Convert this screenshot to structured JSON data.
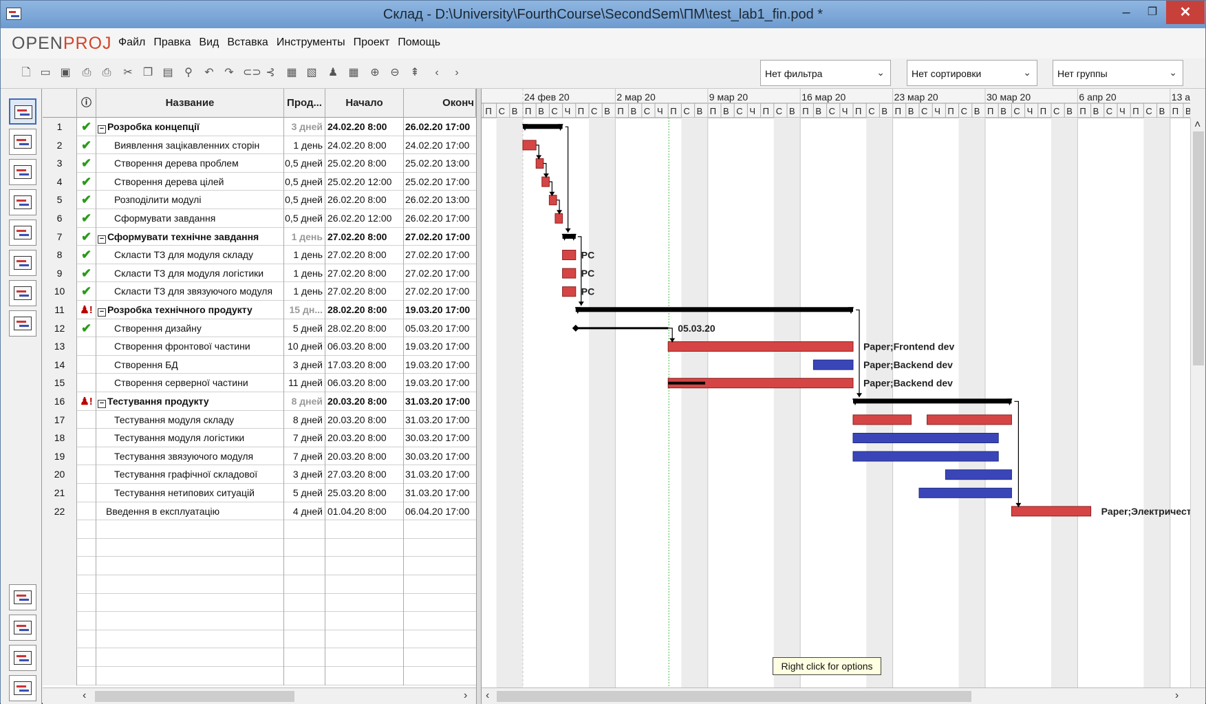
{
  "window": {
    "title": "Склад - D:\\University\\FourthCourse\\SecondSem\\ПМ\\test_lab1_fin.pod *",
    "min": "–",
    "max": "❐",
    "close": "✕"
  },
  "logo": {
    "open": "OPEN",
    "proj": "PROJ"
  },
  "menu": [
    "Файл",
    "Правка",
    "Вид",
    "Вставка",
    "Инструменты",
    "Проект",
    "Помощь"
  ],
  "filters": {
    "filter": "Нет фильтра",
    "sort": "Нет сортировки",
    "group": "Нет группы"
  },
  "columns": {
    "info": "ⓘ",
    "name": "Название",
    "duration": "Прод...",
    "start": "Начало",
    "finish": "Оконч"
  },
  "tasks": [
    {
      "id": "1",
      "ind": "check",
      "name": "Розробка концепції",
      "dur": "3 дней",
      "start": "24.02.20 8:00",
      "end": "26.02.20 17:00",
      "summary": true
    },
    {
      "id": "2",
      "ind": "check",
      "name": "Виявлення зацікавленних сторін",
      "dur": "1 день",
      "start": "24.02.20 8:00",
      "end": "24.02.20 17:00"
    },
    {
      "id": "3",
      "ind": "check",
      "name": "Створення дерева проблем",
      "dur": "0,5 дней",
      "start": "25.02.20 8:00",
      "end": "25.02.20 13:00"
    },
    {
      "id": "4",
      "ind": "check",
      "name": "Створення дерева цілей",
      "dur": "0,5 дней",
      "start": "25.02.20 12:00",
      "end": "25.02.20 17:00"
    },
    {
      "id": "5",
      "ind": "check",
      "name": "Розподілити модулі",
      "dur": "0,5 дней",
      "start": "26.02.20 8:00",
      "end": "26.02.20 13:00"
    },
    {
      "id": "6",
      "ind": "check",
      "name": "Сформувати завдання",
      "dur": "0,5 дней",
      "start": "26.02.20 12:00",
      "end": "26.02.20 17:00"
    },
    {
      "id": "7",
      "ind": "check",
      "name": "Сформувати технічне завдання",
      "dur": "1 день",
      "start": "27.02.20 8:00",
      "end": "27.02.20 17:00",
      "summary": true
    },
    {
      "id": "8",
      "ind": "check",
      "name": "Скласти ТЗ для модуля складу",
      "dur": "1 день",
      "start": "27.02.20 8:00",
      "end": "27.02.20 17:00"
    },
    {
      "id": "9",
      "ind": "check",
      "name": "Скласти ТЗ для модуля логістики",
      "dur": "1 день",
      "start": "27.02.20 8:00",
      "end": "27.02.20 17:00"
    },
    {
      "id": "10",
      "ind": "check",
      "name": "Скласти ТЗ для звязуючого модуля",
      "dur": "1 день",
      "start": "27.02.20 8:00",
      "end": "27.02.20 17:00"
    },
    {
      "id": "11",
      "ind": "warn",
      "name": "Розробка технічного продукту",
      "dur": "15 дн...",
      "start": "28.02.20 8:00",
      "end": "19.03.20 17:00",
      "summary": true
    },
    {
      "id": "12",
      "ind": "check",
      "name": "Створення дизайну",
      "dur": "5 дней",
      "start": "28.02.20 8:00",
      "end": "05.03.20 17:00"
    },
    {
      "id": "13",
      "ind": "",
      "name": "Створення фронтової частини",
      "dur": "10 дней",
      "start": "06.03.20 8:00",
      "end": "19.03.20 17:00"
    },
    {
      "id": "14",
      "ind": "",
      "name": "Створення БД",
      "dur": "3 дней",
      "start": "17.03.20 8:00",
      "end": "19.03.20 17:00"
    },
    {
      "id": "15",
      "ind": "",
      "name": "Створення серверної частини",
      "dur": "11 дней",
      "start": "06.03.20 8:00",
      "end": "19.03.20 17:00"
    },
    {
      "id": "16",
      "ind": "warn",
      "name": "Тестування продукту",
      "dur": "8 дней",
      "start": "20.03.20 8:00",
      "end": "31.03.20 17:00",
      "summary": true
    },
    {
      "id": "17",
      "ind": "",
      "name": "Тестування модуля складу",
      "dur": "8 дней",
      "start": "20.03.20 8:00",
      "end": "31.03.20 17:00"
    },
    {
      "id": "18",
      "ind": "",
      "name": "Тестування модуля логістики",
      "dur": "7 дней",
      "start": "20.03.20 8:00",
      "end": "30.03.20 17:00"
    },
    {
      "id": "19",
      "ind": "",
      "name": "Тестування звязуючого модуля",
      "dur": "7 дней",
      "start": "20.03.20 8:00",
      "end": "30.03.20 17:00"
    },
    {
      "id": "20",
      "ind": "",
      "name": "Тестування графічної складової",
      "dur": "3 дней",
      "start": "27.03.20 8:00",
      "end": "31.03.20 17:00"
    },
    {
      "id": "21",
      "ind": "",
      "name": "Тестування нетипових ситуацій",
      "dur": "5 дней",
      "start": "25.03.20 8:00",
      "end": "31.03.20 17:00"
    },
    {
      "id": "22",
      "ind": "",
      "name": "Введення в експлуатацію",
      "dur": "4 дней",
      "start": "01.04.20 8:00",
      "end": "06.04.20 17:00",
      "top": true
    }
  ],
  "timeline": {
    "weeks": [
      "24 фев 20",
      "2 мар 20",
      "9 мар 20",
      "16 мар 20",
      "23 мар 20",
      "30 мар 20",
      "6 апр 20",
      "13 а"
    ],
    "days": [
      "П",
      "С",
      "В",
      "П",
      "В",
      "С",
      "Ч",
      "П",
      "С",
      "В"
    ]
  },
  "gantt_labels": {
    "r8": "PC",
    "r9": "PC",
    "r10": "PC",
    "r12": "05.03.20",
    "r13": "Paper;Frontend dev",
    "r14": "Paper;Backend dev",
    "r15": "Paper;Backend dev",
    "r22": "Paper;Электричест"
  },
  "colors": {
    "critical": "#d64545",
    "normal": "#3a46b8",
    "summary": "#000000",
    "today": "#46b846"
  },
  "tooltip": "Right click for options"
}
